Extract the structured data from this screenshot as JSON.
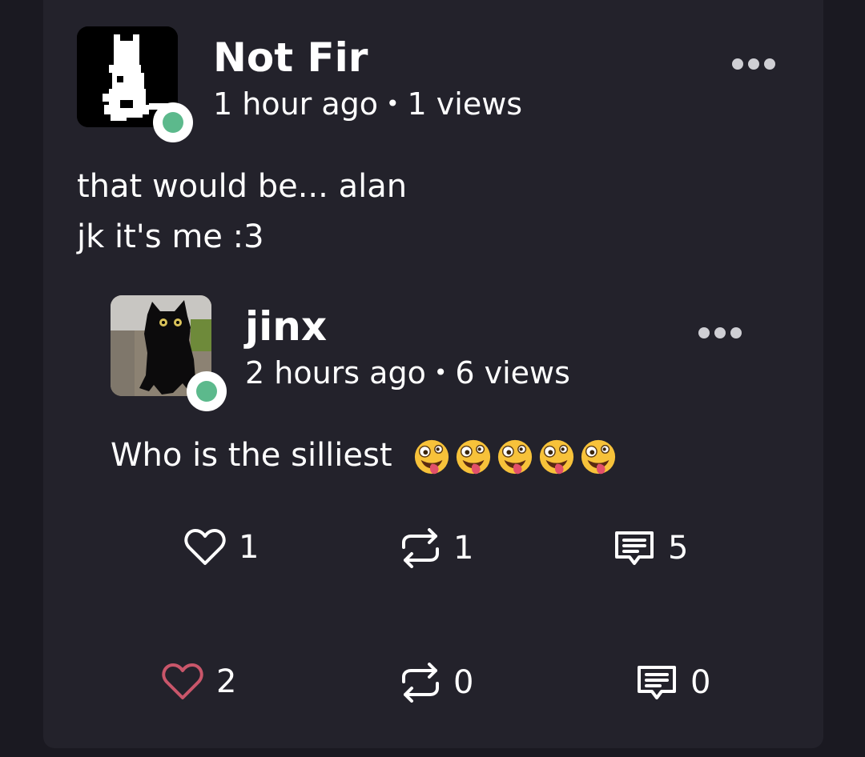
{
  "post": {
    "author": "Not Fir",
    "time": "1 hour ago",
    "views": "1 views",
    "separator": "•",
    "lines": [
      "that would be... alan",
      "jk it's me :3"
    ],
    "online_color": "#5cb98c",
    "actions": {
      "likes": "2",
      "reposts": "0",
      "comments": "0",
      "like_color": "#c9566a"
    }
  },
  "quote": {
    "author": "jinx",
    "time": "2 hours ago",
    "views": "6 views",
    "separator": "•",
    "text": "Who is the silliest",
    "emoji": [
      "zany-face",
      "zany-face",
      "zany-face",
      "zany-face",
      "zany-face"
    ],
    "online_color": "#5cb98c",
    "actions": {
      "likes": "1",
      "reposts": "1",
      "comments": "5"
    }
  },
  "icons": {
    "like": "heart-icon",
    "repost": "repost-icon",
    "comment": "comment-icon",
    "more": "more-icon"
  }
}
